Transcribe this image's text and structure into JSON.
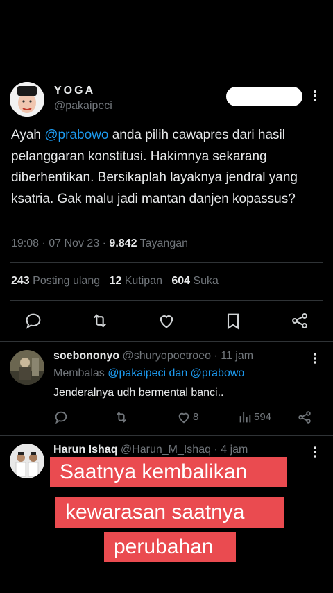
{
  "main_tweet": {
    "name": "YOGA",
    "handle": "@pakaipeci",
    "text_before": "Ayah ",
    "mention": "@prabowo",
    "text_after": " anda pilih cawapres dari hasil pelanggaran konstitusi. Hakimnya sekarang diberhentikan. Bersikaplah layaknya jendral yang ksatria. Gak malu jadi mantan danjen kopassus?",
    "time": "19:08 · 07 Nov 23 · ",
    "views": "9.842",
    "views_label": " Tayangan",
    "retweets": "243",
    "retweets_label": " Posting ulang",
    "quotes": "12",
    "quotes_label": " Kutipan",
    "likes": "604",
    "likes_label": " Suka",
    "icons": [
      "reply-icon",
      "retweet-icon",
      "like-icon",
      "bookmark-icon",
      "share-icon"
    ]
  },
  "replies": [
    {
      "name": "soebononyo",
      "handle_time": " @shuryopoetroeo · 11 jam",
      "replying_label": "Membalas ",
      "replying_to": "@pakaipeci dan @prabowo",
      "text": "Jenderalnya udh bermental banci..",
      "likes": "8",
      "views": "594"
    },
    {
      "name": "Harun Ishaq",
      "handle_time": " @Harun_M_Ishaq · 4 jam"
    }
  ],
  "overlay_caption": {
    "line1": "Saatnya kembalikan",
    "line2": "kewarasan saatnya",
    "line3": "perubahan",
    "background": "#ea4b50"
  },
  "colors": {
    "accent": "#1d9bf0",
    "muted": "#71767b",
    "text": "#e7e9ea",
    "divider": "#2f3336"
  }
}
